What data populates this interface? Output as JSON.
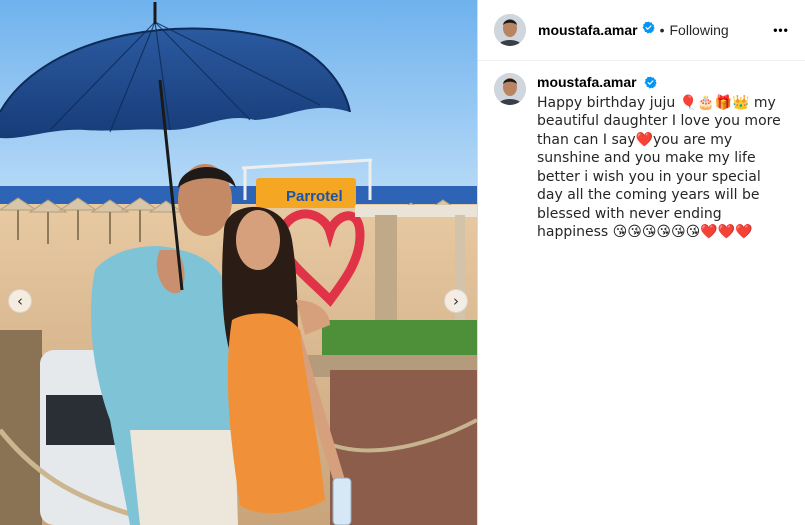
{
  "post": {
    "author": {
      "username": "moustafa.amar",
      "verified": true,
      "follow_status": "Following"
    },
    "media": {
      "description_icons": [
        "chevron-left-icon",
        "chevron-right-icon"
      ],
      "sign_text": "Parrotel"
    },
    "header": {
      "more_label": "•••",
      "separator": "•"
    },
    "caption": {
      "username": "moustafa.amar",
      "text": "Happy birthday juju 🎈🎂🎁👑 my beautiful daughter I love you more than can I say❤️you are my sunshine and you make my life better i wish you in your special day all the coming years will be blessed with never ending happiness 😘😘😘😘😘😘❤️❤️❤️"
    },
    "colors": {
      "verified_blue": "#0095f6",
      "border": "#dbdbdb"
    }
  }
}
